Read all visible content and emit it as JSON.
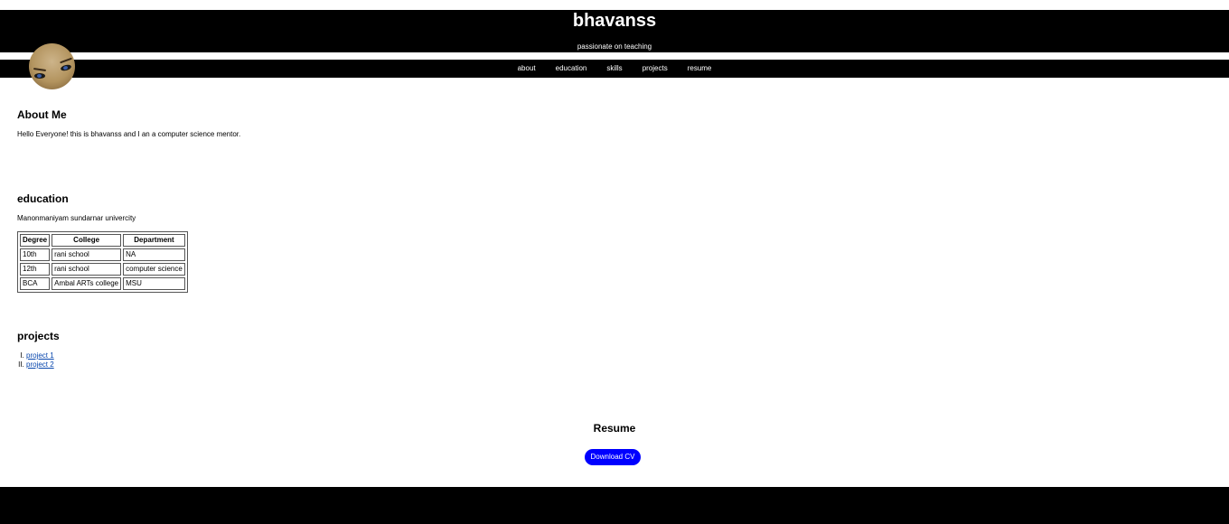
{
  "header": {
    "title": "bhavanss",
    "tagline": "passionate on teaching"
  },
  "nav": {
    "items": [
      {
        "label": "about"
      },
      {
        "label": "education"
      },
      {
        "label": "skills"
      },
      {
        "label": "projects"
      },
      {
        "label": "resume"
      }
    ]
  },
  "about": {
    "heading": "About Me",
    "text": "Hello Everyone! this is bhavanss and I an a computer science mentor."
  },
  "education": {
    "heading": "education",
    "university": "Manonmaniyam sundarnar univercity",
    "table": {
      "headers": [
        "Degree",
        "College",
        "Department"
      ],
      "rows": [
        [
          "10th",
          "rani school",
          "NA"
        ],
        [
          "12th",
          "rani school",
          "computer science"
        ],
        [
          "BCA",
          "Ambal ARTs college",
          "MSU"
        ]
      ]
    }
  },
  "projects": {
    "heading": "projects",
    "items": [
      {
        "label": "project 1"
      },
      {
        "label": "project 2"
      }
    ]
  },
  "resume": {
    "heading": "Resume",
    "button_label": "Download CV"
  }
}
